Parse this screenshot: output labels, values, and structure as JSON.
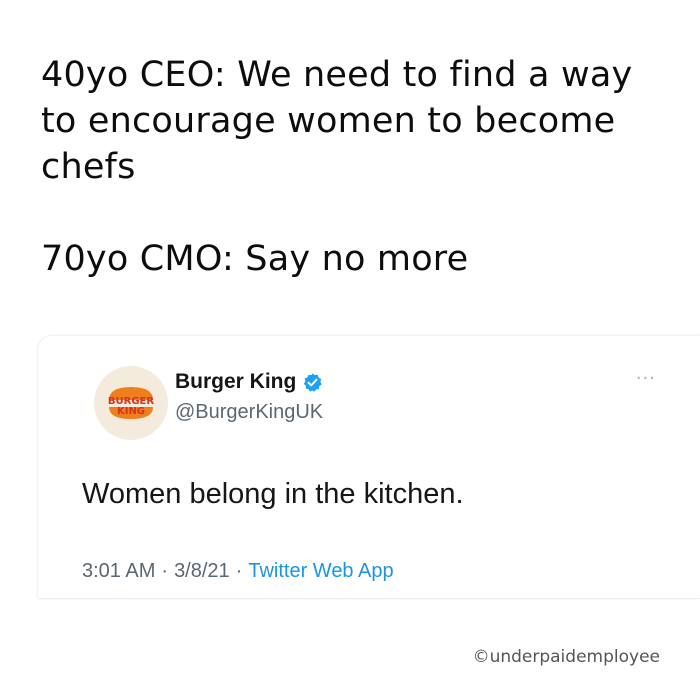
{
  "caption": {
    "lines": [
      "40yo CEO: We need to find a way",
      "to encourage women to become",
      "chefs",
      "70yo CMO: Say no more"
    ]
  },
  "tweet": {
    "display_name": "Burger King",
    "handle": "@BurgerKingUK",
    "text": "Women belong in the kitchen.",
    "time": "3:01 AM",
    "date": "3/8/21",
    "app": "Twitter Web App",
    "separator": "·",
    "more_icon": "···",
    "logo_text": [
      "BURGER",
      "KING"
    ],
    "colors": {
      "verified": "#1da1f2",
      "link": "#1b95e0",
      "logo_orange": "#ef7f1a",
      "logo_red": "#d6331f",
      "avatar_bg": "#f5ebdc"
    }
  },
  "watermark": "©underpaidemployee"
}
